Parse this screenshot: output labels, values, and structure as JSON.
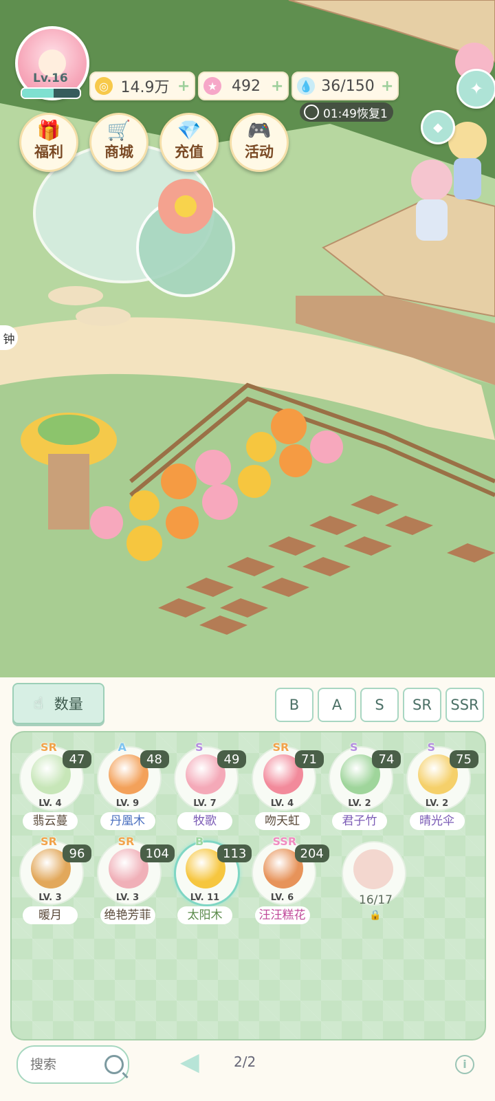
{
  "player": {
    "level_label": "Lv.16",
    "exp_fraction": 0.55
  },
  "resources": {
    "gold": {
      "value": "14.9万",
      "icon": "coin-icon"
    },
    "gem": {
      "value": "492",
      "icon": "star-gem-icon"
    },
    "water": {
      "value": "36/150",
      "icon": "water-drop-icon"
    }
  },
  "timer": {
    "text": "01:49恢复1"
  },
  "menu": {
    "welfare": "福利",
    "shop": "商城",
    "recharge": "充值",
    "event": "活动"
  },
  "side_label": "钟",
  "panel": {
    "quantity_label": "数量",
    "rarity_filters": [
      "B",
      "A",
      "S",
      "SR",
      "SSR"
    ],
    "items": [
      {
        "rank": "SR",
        "count": "47",
        "level": "LV. 4",
        "name": "翡云蔓",
        "color": "#c7e6b8",
        "rank_color": "#f1a34a",
        "name_color": "#5a4a3a"
      },
      {
        "rank": "A",
        "count": "48",
        "level": "LV. 9",
        "name": "丹凰木",
        "color": "#f3a15a",
        "rank_color": "#7fc4f0",
        "name_color": "#4a6fbf"
      },
      {
        "rank": "S",
        "count": "49",
        "level": "LV. 7",
        "name": "牧歌",
        "color": "#f4a9b8",
        "rank_color": "#b48de0",
        "name_color": "#7a5ab5"
      },
      {
        "rank": "SR",
        "count": "71",
        "level": "LV. 4",
        "name": "吻天虹",
        "color": "#f28a9b",
        "rank_color": "#f1a34a",
        "name_color": "#5a4a3a"
      },
      {
        "rank": "S",
        "count": "74",
        "level": "LV. 2",
        "name": "君子竹",
        "color": "#9fd59b",
        "rank_color": "#b48de0",
        "name_color": "#7a5ab5"
      },
      {
        "rank": "S",
        "count": "75",
        "level": "LV. 2",
        "name": "晴光伞",
        "color": "#f5d06a",
        "rank_color": "#b48de0",
        "name_color": "#7a5ab5"
      },
      {
        "rank": "SR",
        "count": "96",
        "level": "LV. 3",
        "name": "暖月",
        "color": "#e2a85b",
        "rank_color": "#f1a34a",
        "name_color": "#5a4a3a"
      },
      {
        "rank": "SR",
        "count": "104",
        "level": "LV. 3",
        "name": "绝艳芳菲",
        "color": "#f0b0b8",
        "rank_color": "#f1a34a",
        "name_color": "#5a4a3a"
      },
      {
        "rank": "B",
        "count": "113",
        "level": "LV. 11",
        "name": "太阳木",
        "color": "#f6c63f",
        "rank_color": "#9dd7a0",
        "name_color": "#5a8a4a"
      },
      {
        "rank": "SSR",
        "count": "204",
        "level": "LV. 6",
        "name": "汪汪糕花",
        "color": "#e7935a",
        "rank_color": "#f08cc0",
        "name_color": "#c04a9a"
      }
    ],
    "locked": {
      "progress": "16/17"
    },
    "search_placeholder": "搜索",
    "page": "2/2"
  }
}
